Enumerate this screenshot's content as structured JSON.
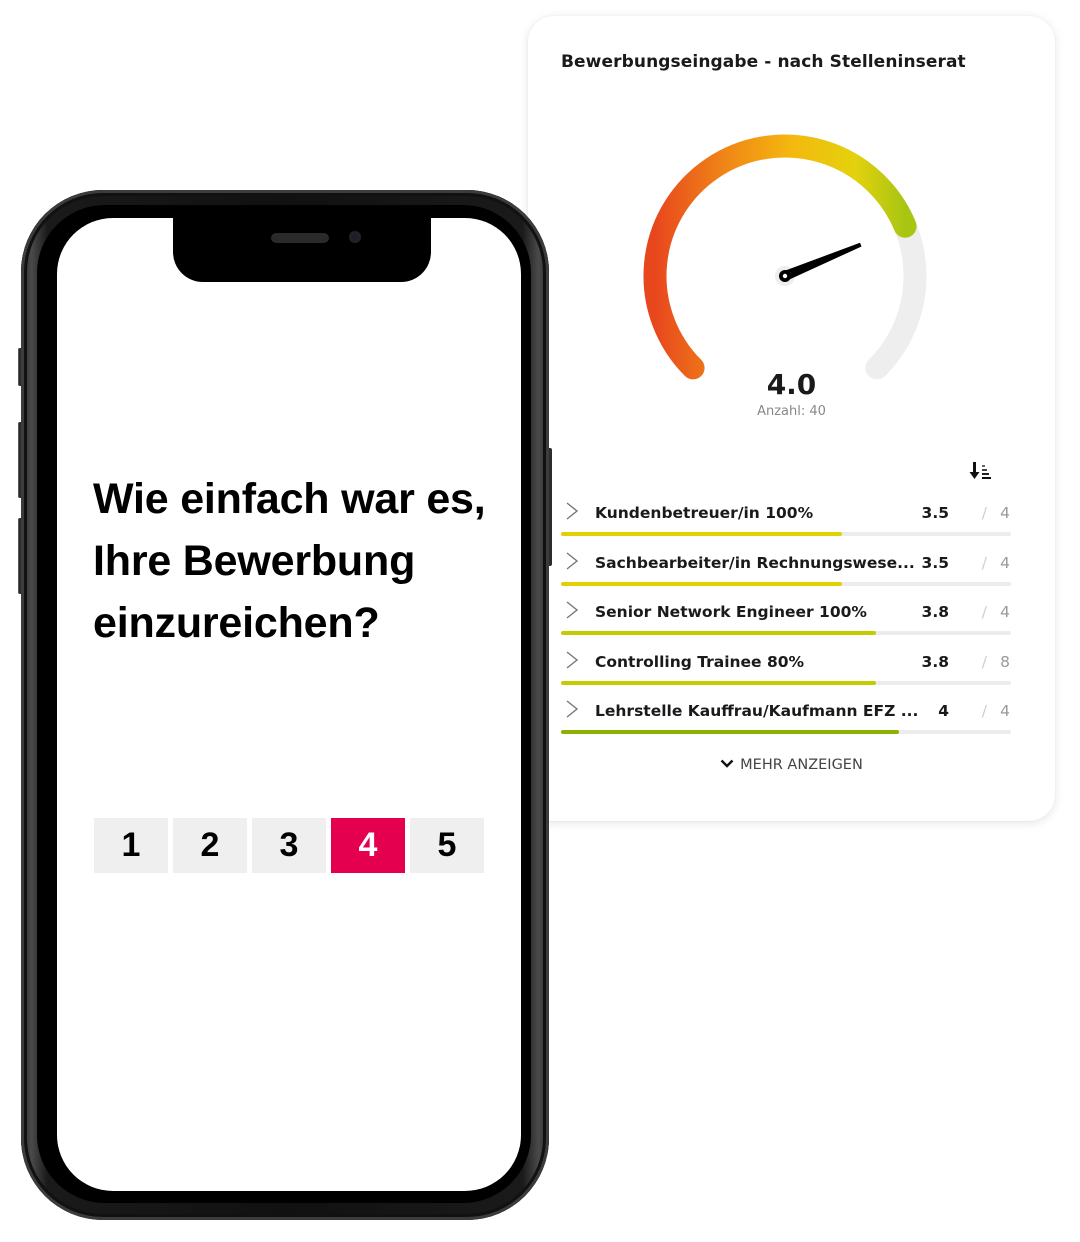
{
  "card": {
    "title": "Bewerbungseingabe - nach Stelleninserat",
    "gauge": {
      "value": 4.0,
      "value_label": "4.0",
      "min": 1,
      "max": 5,
      "count_label": "Anzahl: 40",
      "gradient_colors": [
        "#e8471e",
        "#f08a16",
        "#f5b80f",
        "#e3d20d",
        "#a8c512"
      ],
      "track_color": "#eeeeee",
      "needle_color": "#000000"
    },
    "sort_icon": "sort-descending-icon",
    "rows": [
      {
        "label": "Kundenbetreuer/in 100%",
        "score": 3.5,
        "score_label": "3.5",
        "count": "4",
        "color": "#e2d100"
      },
      {
        "label": "Sachbearbeiter/in Rechnungswese...",
        "score": 3.5,
        "score_label": "3.5",
        "count": "4",
        "color": "#e2d100"
      },
      {
        "label": "Senior Network Engineer 100%",
        "score": 3.8,
        "score_label": "3.8",
        "count": "4",
        "color": "#c3cc00"
      },
      {
        "label": "Controlling Trainee 80%",
        "score": 3.8,
        "score_label": "3.8",
        "count": "8",
        "color": "#c3cc00"
      },
      {
        "label": "Lehrstelle Kauffrau/Kaufmann EFZ ...",
        "score": 4,
        "score_label": "4",
        "count": "4",
        "color": "#8ab200"
      }
    ],
    "slash": "/",
    "more_label": "MEHR ANZEIGEN"
  },
  "phone": {
    "question": "Wie einfach war es, Ihre Bewerbung einzureichen?",
    "scale": [
      "1",
      "2",
      "3",
      "4",
      "5"
    ],
    "selected": "4",
    "accent_color": "#e5004f"
  }
}
